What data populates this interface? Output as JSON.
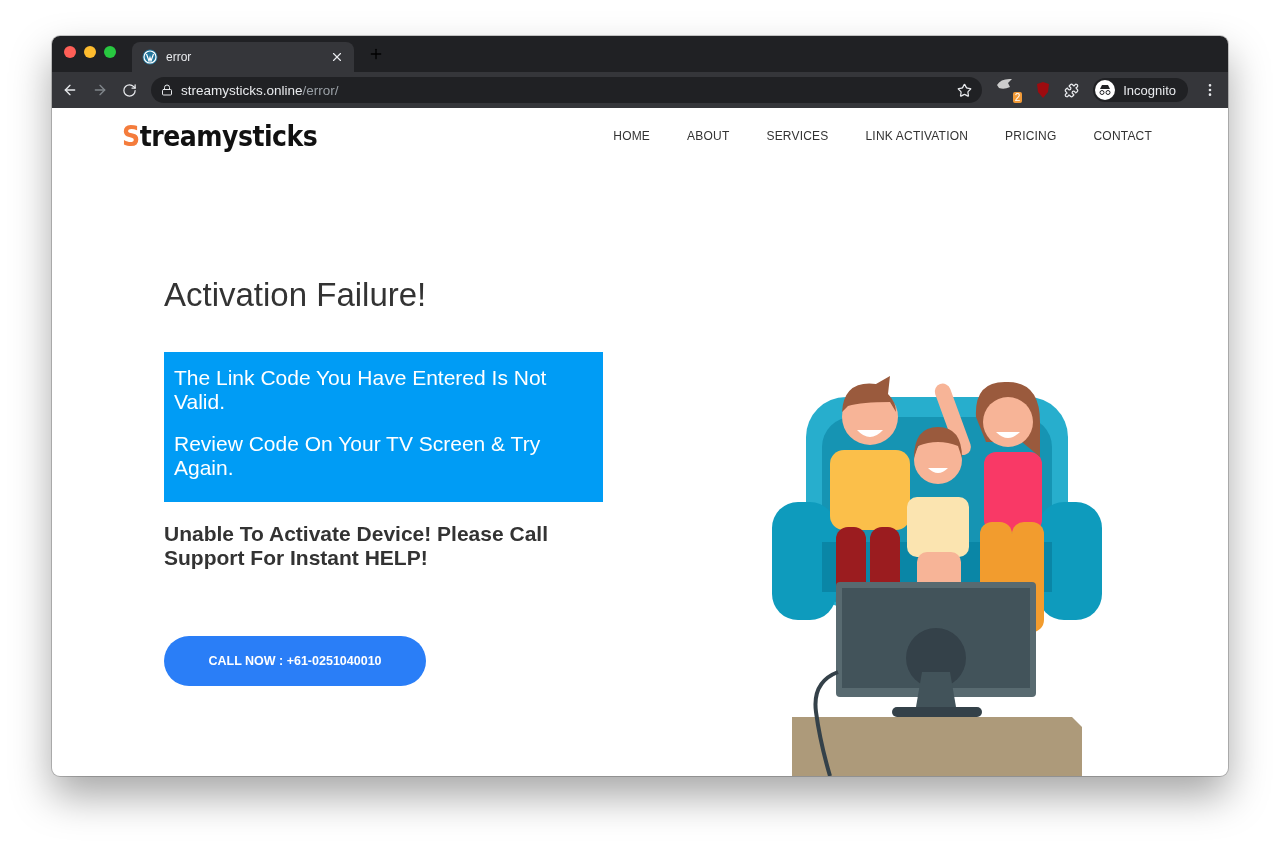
{
  "browser": {
    "tab": {
      "title": "error"
    },
    "url": {
      "host": "streamysticks.online",
      "path": "/error/"
    },
    "extension_badge": "2",
    "profile": "Incognito"
  },
  "site": {
    "logo": "Streamysticks",
    "nav": [
      {
        "label": "HOME"
      },
      {
        "label": "ABOUT"
      },
      {
        "label": "SERVICES"
      },
      {
        "label": "LINK ACTIVATION"
      },
      {
        "label": "PRICING"
      },
      {
        "label": "CONTACT"
      }
    ]
  },
  "content": {
    "title": "Activation Failure!",
    "alert": [
      "The Link Code You Have Entered Is Not Valid.",
      "Review Code On Your TV Screen & Try Again."
    ],
    "message": "Unable To Activate Device! Please Call Support For Instant HELP!",
    "call_button": "CALL NOW : +61-0251040010"
  }
}
